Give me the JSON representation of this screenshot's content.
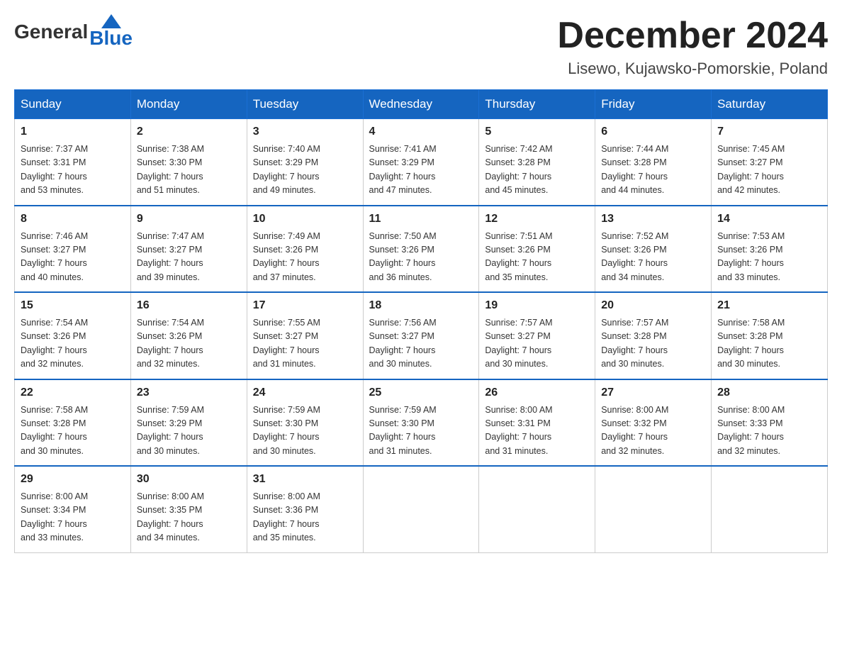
{
  "header": {
    "logo_general": "General",
    "logo_blue": "Blue",
    "month_title": "December 2024",
    "location": "Lisewo, Kujawsko-Pomorskie, Poland"
  },
  "weekdays": [
    "Sunday",
    "Monday",
    "Tuesday",
    "Wednesday",
    "Thursday",
    "Friday",
    "Saturday"
  ],
  "weeks": [
    [
      {
        "day": "1",
        "sunrise": "7:37 AM",
        "sunset": "3:31 PM",
        "daylight": "7 hours and 53 minutes."
      },
      {
        "day": "2",
        "sunrise": "7:38 AM",
        "sunset": "3:30 PM",
        "daylight": "7 hours and 51 minutes."
      },
      {
        "day": "3",
        "sunrise": "7:40 AM",
        "sunset": "3:29 PM",
        "daylight": "7 hours and 49 minutes."
      },
      {
        "day": "4",
        "sunrise": "7:41 AM",
        "sunset": "3:29 PM",
        "daylight": "7 hours and 47 minutes."
      },
      {
        "day": "5",
        "sunrise": "7:42 AM",
        "sunset": "3:28 PM",
        "daylight": "7 hours and 45 minutes."
      },
      {
        "day": "6",
        "sunrise": "7:44 AM",
        "sunset": "3:28 PM",
        "daylight": "7 hours and 44 minutes."
      },
      {
        "day": "7",
        "sunrise": "7:45 AM",
        "sunset": "3:27 PM",
        "daylight": "7 hours and 42 minutes."
      }
    ],
    [
      {
        "day": "8",
        "sunrise": "7:46 AM",
        "sunset": "3:27 PM",
        "daylight": "7 hours and 40 minutes."
      },
      {
        "day": "9",
        "sunrise": "7:47 AM",
        "sunset": "3:27 PM",
        "daylight": "7 hours and 39 minutes."
      },
      {
        "day": "10",
        "sunrise": "7:49 AM",
        "sunset": "3:26 PM",
        "daylight": "7 hours and 37 minutes."
      },
      {
        "day": "11",
        "sunrise": "7:50 AM",
        "sunset": "3:26 PM",
        "daylight": "7 hours and 36 minutes."
      },
      {
        "day": "12",
        "sunrise": "7:51 AM",
        "sunset": "3:26 PM",
        "daylight": "7 hours and 35 minutes."
      },
      {
        "day": "13",
        "sunrise": "7:52 AM",
        "sunset": "3:26 PM",
        "daylight": "7 hours and 34 minutes."
      },
      {
        "day": "14",
        "sunrise": "7:53 AM",
        "sunset": "3:26 PM",
        "daylight": "7 hours and 33 minutes."
      }
    ],
    [
      {
        "day": "15",
        "sunrise": "7:54 AM",
        "sunset": "3:26 PM",
        "daylight": "7 hours and 32 minutes."
      },
      {
        "day": "16",
        "sunrise": "7:54 AM",
        "sunset": "3:26 PM",
        "daylight": "7 hours and 32 minutes."
      },
      {
        "day": "17",
        "sunrise": "7:55 AM",
        "sunset": "3:27 PM",
        "daylight": "7 hours and 31 minutes."
      },
      {
        "day": "18",
        "sunrise": "7:56 AM",
        "sunset": "3:27 PM",
        "daylight": "7 hours and 30 minutes."
      },
      {
        "day": "19",
        "sunrise": "7:57 AM",
        "sunset": "3:27 PM",
        "daylight": "7 hours and 30 minutes."
      },
      {
        "day": "20",
        "sunrise": "7:57 AM",
        "sunset": "3:28 PM",
        "daylight": "7 hours and 30 minutes."
      },
      {
        "day": "21",
        "sunrise": "7:58 AM",
        "sunset": "3:28 PM",
        "daylight": "7 hours and 30 minutes."
      }
    ],
    [
      {
        "day": "22",
        "sunrise": "7:58 AM",
        "sunset": "3:28 PM",
        "daylight": "7 hours and 30 minutes."
      },
      {
        "day": "23",
        "sunrise": "7:59 AM",
        "sunset": "3:29 PM",
        "daylight": "7 hours and 30 minutes."
      },
      {
        "day": "24",
        "sunrise": "7:59 AM",
        "sunset": "3:30 PM",
        "daylight": "7 hours and 30 minutes."
      },
      {
        "day": "25",
        "sunrise": "7:59 AM",
        "sunset": "3:30 PM",
        "daylight": "7 hours and 31 minutes."
      },
      {
        "day": "26",
        "sunrise": "8:00 AM",
        "sunset": "3:31 PM",
        "daylight": "7 hours and 31 minutes."
      },
      {
        "day": "27",
        "sunrise": "8:00 AM",
        "sunset": "3:32 PM",
        "daylight": "7 hours and 32 minutes."
      },
      {
        "day": "28",
        "sunrise": "8:00 AM",
        "sunset": "3:33 PM",
        "daylight": "7 hours and 32 minutes."
      }
    ],
    [
      {
        "day": "29",
        "sunrise": "8:00 AM",
        "sunset": "3:34 PM",
        "daylight": "7 hours and 33 minutes."
      },
      {
        "day": "30",
        "sunrise": "8:00 AM",
        "sunset": "3:35 PM",
        "daylight": "7 hours and 34 minutes."
      },
      {
        "day": "31",
        "sunrise": "8:00 AM",
        "sunset": "3:36 PM",
        "daylight": "7 hours and 35 minutes."
      },
      null,
      null,
      null,
      null
    ]
  ],
  "labels": {
    "sunrise": "Sunrise: ",
    "sunset": "Sunset: ",
    "daylight": "Daylight: "
  }
}
